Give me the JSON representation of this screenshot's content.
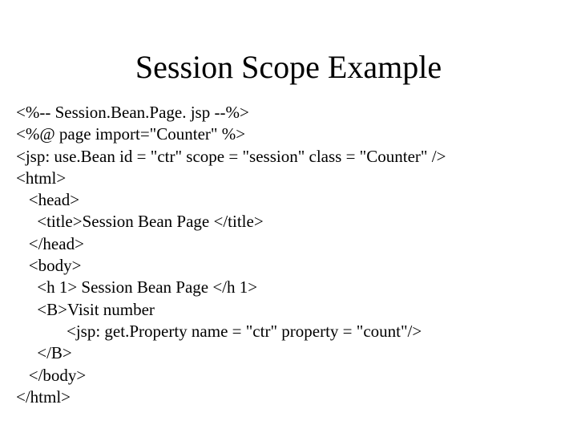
{
  "title": "Session Scope Example",
  "code": {
    "line1": "<%-- Session.Bean.Page. jsp --%>",
    "line2": "<%@ page import=\"Counter\" %>",
    "line3": "<jsp: use.Bean id = \"ctr\" scope = \"session\" class = \"Counter\" />",
    "line4": "<html>",
    "line5": "   <head>",
    "line6": "     <title>Session Bean Page </title>",
    "line7": "   </head>",
    "line8": "   <body>",
    "line9": "     <h 1> Session Bean Page </h 1>",
    "line10": "     <B>Visit number",
    "line11": "            <jsp: get.Property name = \"ctr\" property = \"count\"/>",
    "line12": "     </B>",
    "line13": "   </body>",
    "line14": "</html>"
  }
}
